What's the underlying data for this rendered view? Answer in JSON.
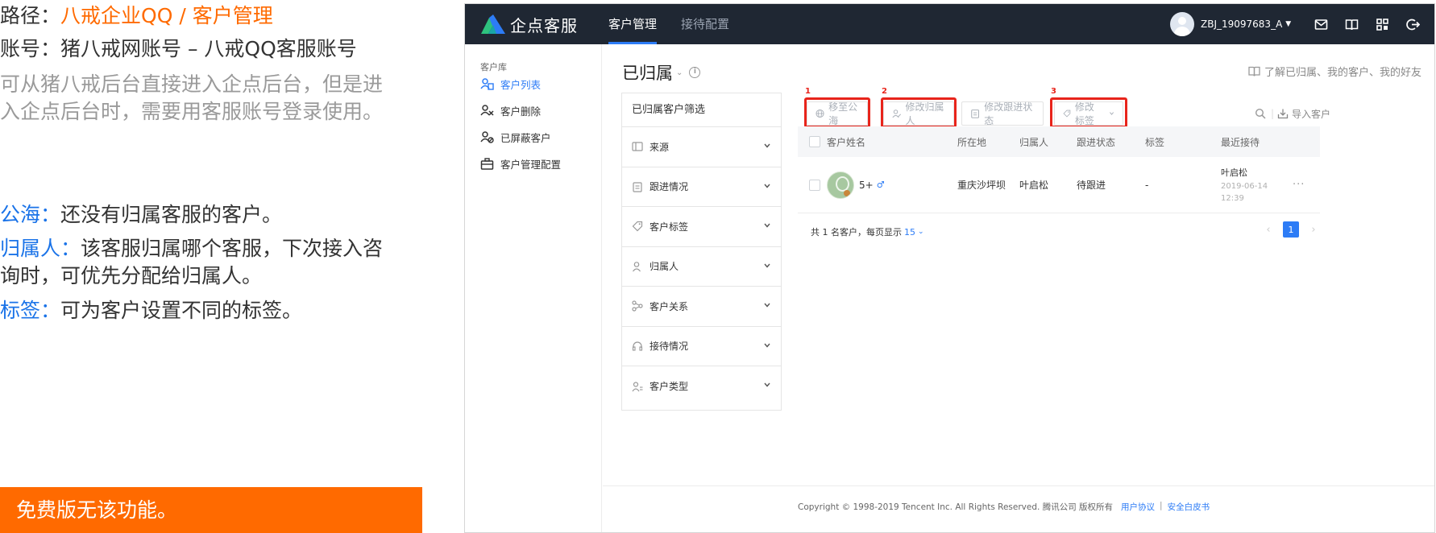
{
  "explain": {
    "path_label": "路径：",
    "path_value": "八戒企业QQ / 客户管理",
    "account_label": "账号：",
    "account_value": "猪八戒网账号 – 八戒QQ客服账号",
    "note_line1": "可从猪八戒后台直接进入企点后台，但是进",
    "note_line2": "入企点后台时，需要用客服账号登录使用。",
    "gonghai_label": "公海：",
    "gonghai_value": "还没有归属客服的客户。",
    "owner_label": "归属人：",
    "owner_value_line1": "该客服归属哪个客服，下次接入咨",
    "owner_value_line2": "询时，可优先分配给归属人。",
    "tag_label": "标签：",
    "tag_value": "可为客户设置不同的标签。",
    "banner": "免费版无该功能。"
  },
  "app": {
    "logo_text": "企点客服",
    "nav": [
      {
        "label": "客户管理",
        "active": true
      },
      {
        "label": "接待配置",
        "active": false
      }
    ],
    "user_name": "ZBJ_19097683_A",
    "sidebar": {
      "group": "客户库",
      "items": [
        {
          "label": "客户列表",
          "icon": "customer-list-icon",
          "active": true
        },
        {
          "label": "客户删除",
          "icon": "customer-delete-icon",
          "active": false
        },
        {
          "label": "已屏蔽客户",
          "icon": "blocked-customer-icon",
          "active": false
        },
        {
          "label": "客户管理配置",
          "icon": "briefcase-icon",
          "active": false
        }
      ]
    },
    "page_title": "已归属",
    "help_link": "了解已归属、我的客户、我的好友",
    "filter": {
      "title": "已归属客户筛选",
      "items": [
        {
          "label": "来源",
          "icon": "source-icon"
        },
        {
          "label": "跟进情况",
          "icon": "clipboard-icon"
        },
        {
          "label": "客户标签",
          "icon": "tag-icon"
        },
        {
          "label": "归属人",
          "icon": "person-icon"
        },
        {
          "label": "客户关系",
          "icon": "relation-icon"
        },
        {
          "label": "接待情况",
          "icon": "headset-icon"
        },
        {
          "label": "客户类型",
          "icon": "type-icon"
        }
      ]
    },
    "toolbar": {
      "move_public": "移至公海",
      "change_owner": "修改归属人",
      "change_status": "修改跟进状态",
      "change_tag": "修改标签",
      "import": "导入客户",
      "markers": [
        "1",
        "2",
        "3"
      ]
    },
    "table": {
      "headers": [
        "客户姓名",
        "所在地",
        "归属人",
        "跟进状态",
        "标签",
        "最近接待"
      ],
      "rows": [
        {
          "name": "5+",
          "gender": "♂",
          "location": "重庆沙坪坝",
          "owner": "叶启松",
          "status": "待跟进",
          "tag": "-",
          "recent_name": "叶启松",
          "recent_date": "2019-06-14",
          "recent_time": "12:39",
          "more": "···"
        }
      ]
    },
    "pager": {
      "summary": "共 1 名客户，每页显示",
      "page_size": "15",
      "current_page": "1"
    },
    "footer": {
      "copyright": "Copyright © 1998-2019 Tencent Inc. All Rights Reserved. 腾讯公司 版权所有",
      "link1": "用户协议",
      "separator": "|",
      "link2": "安全白皮书"
    }
  },
  "colors": {
    "accent_orange": "#ff6a00",
    "accent_blue": "#2d7cf6",
    "topbar": "#1f2733",
    "highlight_red": "#e8241b"
  }
}
